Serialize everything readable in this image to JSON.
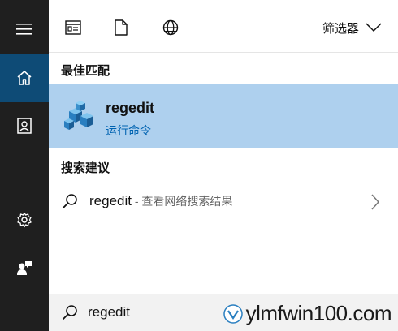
{
  "sidebar": {
    "items": [
      {
        "icon": "menu-icon"
      },
      {
        "icon": "home-icon",
        "active": true
      },
      {
        "icon": "notebook-icon"
      },
      {
        "icon": "gear-icon"
      },
      {
        "icon": "feedback-icon"
      }
    ]
  },
  "topbar": {
    "tabs": [
      {
        "icon": "apps-icon"
      },
      {
        "icon": "document-icon"
      },
      {
        "icon": "web-icon"
      }
    ],
    "filter_label": "筛选器"
  },
  "best_match": {
    "heading": "最佳匹配",
    "app_name": "regedit",
    "app_type": "运行命令"
  },
  "suggestions": {
    "heading": "搜索建议",
    "items": [
      {
        "query": "regedit",
        "sub": " - 查看网络搜索结果"
      }
    ]
  },
  "search": {
    "value": "regedit"
  },
  "watermark": {
    "text": "ylmfwin100.com"
  },
  "colors": {
    "sidebar_bg": "#1f1f1f",
    "sidebar_active": "#0e4b76",
    "selection_bg": "#aed0ee",
    "accent": "#0063b1"
  }
}
